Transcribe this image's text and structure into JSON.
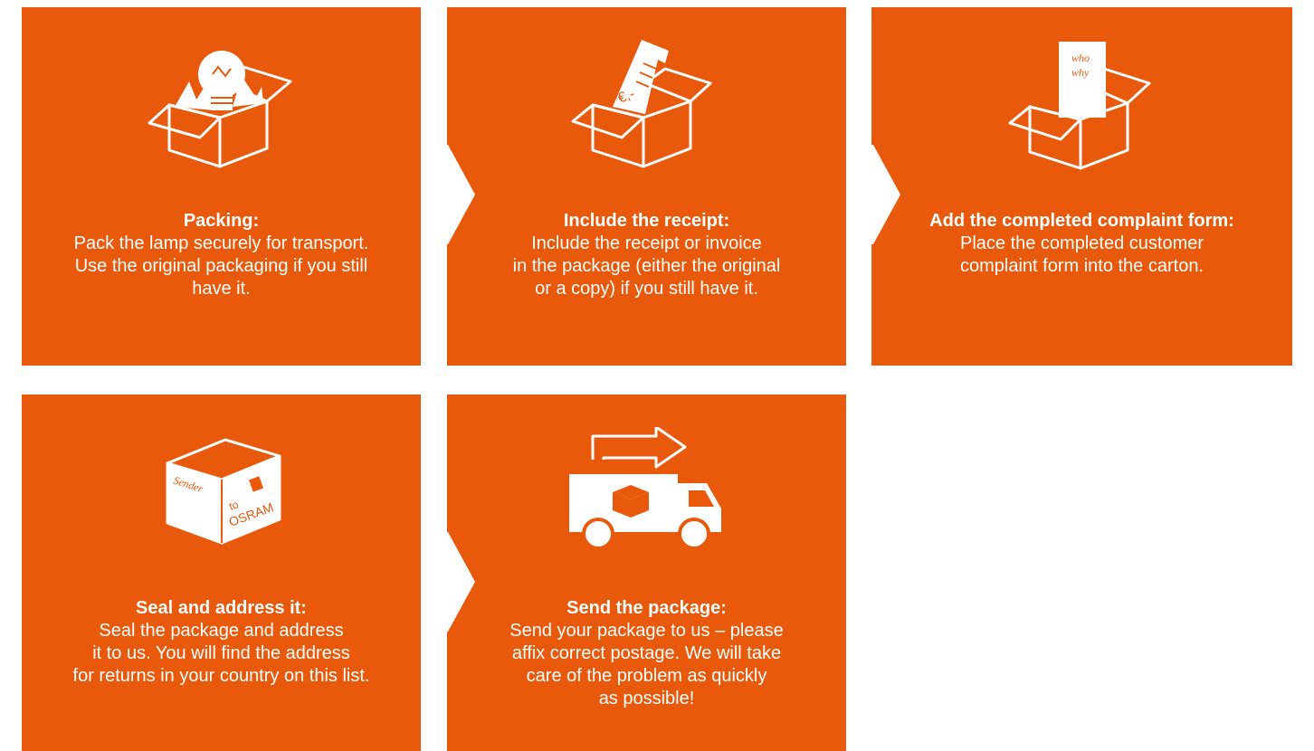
{
  "colors": {
    "card_background": "#e8590c",
    "text": "#ffffff",
    "page_background": "#ffffff"
  },
  "steps": [
    {
      "title": "Packing:",
      "lines": [
        "Pack the lamp securely for transport.",
        "Use the original packaging if you still",
        "have it."
      ],
      "icon": "box-with-lamp-icon"
    },
    {
      "title": "Include the receipt:",
      "lines": [
        "Include the receipt or invoice",
        "in the package (either the original",
        "or a copy) if you still have it."
      ],
      "icon": "box-with-receipt-icon",
      "icon_text": "€,-"
    },
    {
      "title": "Add the completed complaint form:",
      "lines": [
        "Place the completed customer",
        "complaint form into the carton."
      ],
      "icon": "box-with-form-icon",
      "icon_text": [
        "who",
        "why"
      ]
    },
    {
      "title": "Seal and address it:",
      "lines": [
        "Seal the package and address",
        "it to us. You will find the address",
        "for returns in your country on this list."
      ],
      "icon": "sealed-box-icon",
      "icon_text": [
        "Sender",
        "to",
        "OSRAM"
      ]
    },
    {
      "title": "Send the package:",
      "lines": [
        "Send your package to us – please",
        "affix correct postage. We will take",
        "care of the problem as quickly",
        "as possible!"
      ],
      "icon": "delivery-truck-icon"
    }
  ]
}
